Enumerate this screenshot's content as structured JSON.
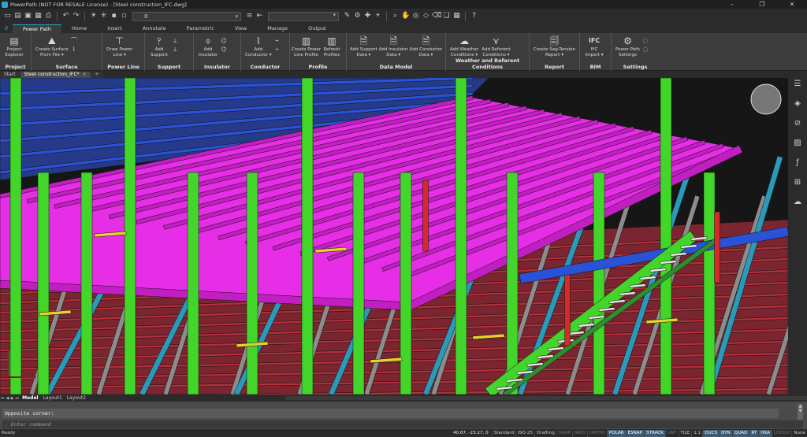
{
  "window": {
    "title": "PowerPath (NOT FOR RESALE License) - [Steel construction_IFC.dwg]"
  },
  "quick_access": {
    "layer_value": "0"
  },
  "ribbon_tabs": [
    "Power Path",
    "Home",
    "Insert",
    "Annotate",
    "Parametric",
    "View",
    "Manage",
    "Output"
  ],
  "ribbon_groups": [
    {
      "label": "Project",
      "buttons": [
        {
          "label": "Project\nExplorer",
          "icon": "project-explorer-icon"
        }
      ]
    },
    {
      "label": "Surface",
      "buttons": [
        {
          "label": "Create Surface\nFrom File ▾",
          "icon": "surface-icon"
        }
      ]
    },
    {
      "label": "Power Line",
      "buttons": [
        {
          "label": "Draw Power\nLine ▾",
          "icon": "power-line-icon"
        }
      ]
    },
    {
      "label": "Support",
      "buttons": [
        {
          "label": "Add\nSupport",
          "icon": "support-icon"
        }
      ]
    },
    {
      "label": "Insulator",
      "buttons": [
        {
          "label": "Add\nInsulator",
          "icon": "insulator-icon"
        }
      ]
    },
    {
      "label": "Conductor",
      "buttons": [
        {
          "label": "Add\nConductor ▾",
          "icon": "conductor-icon"
        }
      ]
    },
    {
      "label": "Profile",
      "buttons": [
        {
          "label": "Create Power\nLine Profile",
          "icon": "profile-icon"
        },
        {
          "label": "Refresh\nProfiles",
          "icon": "refresh-profiles-icon"
        }
      ]
    },
    {
      "label": "Data Model",
      "buttons": [
        {
          "label": "Add Support\nData ▾",
          "icon": "support-data-icon"
        },
        {
          "label": "Add Insulator\nData ▾",
          "icon": "insulator-data-icon"
        },
        {
          "label": "Add Conductor\nData ▾",
          "icon": "conductor-data-icon"
        }
      ]
    },
    {
      "label": "Weather and Referent Conditions",
      "buttons": [
        {
          "label": "Add Weather\nConditions ▾",
          "icon": "weather-icon"
        },
        {
          "label": "Add Referent\nConditions ▾",
          "icon": "referent-icon"
        }
      ]
    },
    {
      "label": "Report",
      "buttons": [
        {
          "label": "Create Sag-Tension\nReport ▾",
          "icon": "report-icon"
        }
      ]
    },
    {
      "label": "BIM",
      "buttons": [
        {
          "label": "IFC\nImport ▾",
          "icon": "ifc-icon"
        }
      ]
    },
    {
      "label": "Settings",
      "buttons": [
        {
          "label": "Power Path\nSettings",
          "icon": "settings-gear-icon"
        }
      ]
    }
  ],
  "doc_tabs": [
    "Start",
    "Steel construction_IFC*"
  ],
  "layout_tabs": [
    "Model",
    "Layout1",
    "Layout2"
  ],
  "command": {
    "history": "Opposite corner:",
    "placeholder": ": Enter command"
  },
  "status": {
    "ready": "Ready",
    "coords": "40.67, -23.27, 0",
    "items": [
      {
        "label": "Standard",
        "state": "text"
      },
      {
        "label": "ISO-25",
        "state": "text"
      },
      {
        "label": "Drafting",
        "state": "text"
      },
      {
        "label": "SNAP",
        "state": "off"
      },
      {
        "label": "GRID",
        "state": "off"
      },
      {
        "label": "ORTHO",
        "state": "off"
      },
      {
        "label": "POLAR",
        "state": "on"
      },
      {
        "label": "ESNAP",
        "state": "on"
      },
      {
        "label": "STRACK",
        "state": "on"
      },
      {
        "label": "LWT",
        "state": "off"
      },
      {
        "label": "TILE",
        "state": "text"
      },
      {
        "label": "1:1",
        "state": "text"
      },
      {
        "label": "DUCS",
        "state": "on"
      },
      {
        "label": "DYN",
        "state": "on"
      },
      {
        "label": "QUAD",
        "state": "on"
      },
      {
        "label": "RT",
        "state": "on"
      },
      {
        "label": "HKA",
        "state": "on"
      },
      {
        "label": "LOCKUI",
        "state": "off"
      },
      {
        "label": "None",
        "state": "text"
      }
    ]
  },
  "colors": {
    "magenta": "#e62ee6",
    "green": "#43d62a",
    "blue": "#2a52d6",
    "teal": "#2a9ab8",
    "red": "#b3303a",
    "grey": "#8c8c8c",
    "yellow": "#e6d22a"
  }
}
